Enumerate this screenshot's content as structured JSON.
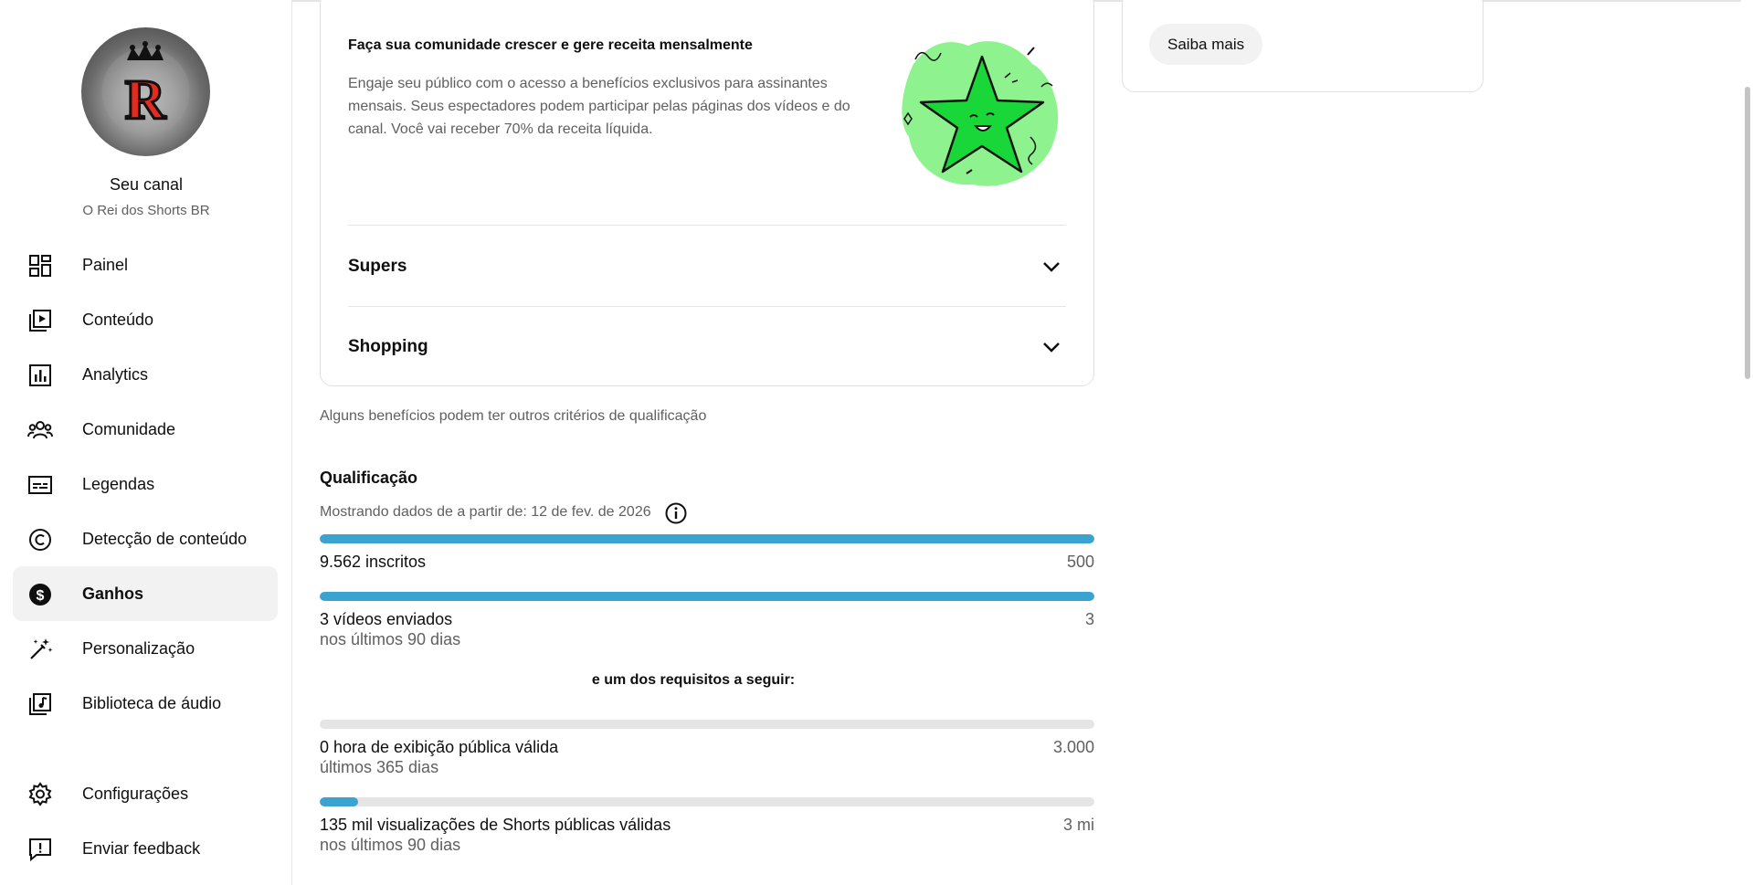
{
  "sidebar": {
    "channel_title": "Seu canal",
    "channel_name": "O Rei dos Shorts BR",
    "avatar_letter": "R",
    "items": [
      {
        "label": "Painel",
        "icon": "dashboard-icon"
      },
      {
        "label": "Conteúdo",
        "icon": "content-icon"
      },
      {
        "label": "Analytics",
        "icon": "analytics-icon"
      },
      {
        "label": "Comunidade",
        "icon": "community-icon"
      },
      {
        "label": "Legendas",
        "icon": "subtitles-icon"
      },
      {
        "label": "Detecção de conteúdo",
        "icon": "copyright-icon"
      },
      {
        "label": "Ganhos",
        "icon": "dollar-icon",
        "active": true
      },
      {
        "label": "Personalização",
        "icon": "magic-wand-icon"
      },
      {
        "label": "Biblioteca de áudio",
        "icon": "audio-library-icon"
      }
    ],
    "bottom_items": [
      {
        "label": "Configurações",
        "icon": "gear-icon"
      },
      {
        "label": "Enviar feedback",
        "icon": "feedback-icon"
      }
    ]
  },
  "benefits": {
    "heading": "Faça sua comunidade crescer e gere receita mensalmente",
    "body": "Engaje seu público com o acesso a benefícios exclusivos para assinantes mensais. Seus espectadores podem participar pelas páginas dos vídeos e do canal. Você vai receber 70% da receita líquida.",
    "accordions": [
      "Supers",
      "Shopping"
    ]
  },
  "note": "Alguns benefícios podem ter outros critérios de qualificação",
  "qualification": {
    "title": "Qualificação",
    "subtitle": "Mostrando dados de a partir de: 12 de fev. de 2026",
    "requirements": [
      {
        "label": "9.562 inscritos",
        "sub": "",
        "target": "500",
        "progress": 1.0
      },
      {
        "label": "3 vídeos enviados",
        "sub": "nos últimos 90 dias",
        "target": "3",
        "progress": 1.0
      }
    ],
    "or_text": "e um dos requisitos a seguir:",
    "alternatives": [
      {
        "label": "0 hora de exibição pública válida",
        "sub": "últimos 365 dias",
        "target": "3.000",
        "progress": 0.0
      },
      {
        "label": "135 mil visualizações de Shorts públicas válidas",
        "sub": "nos últimos 90 dias",
        "target": "3 mi",
        "progress": 0.05
      }
    ]
  },
  "right_card": {
    "button_label": "Saiba mais"
  },
  "colors": {
    "progress_fill": "#3ba3d0",
    "progress_track": "#e5e5e5",
    "active_nav_bg": "#f2f2f2"
  }
}
